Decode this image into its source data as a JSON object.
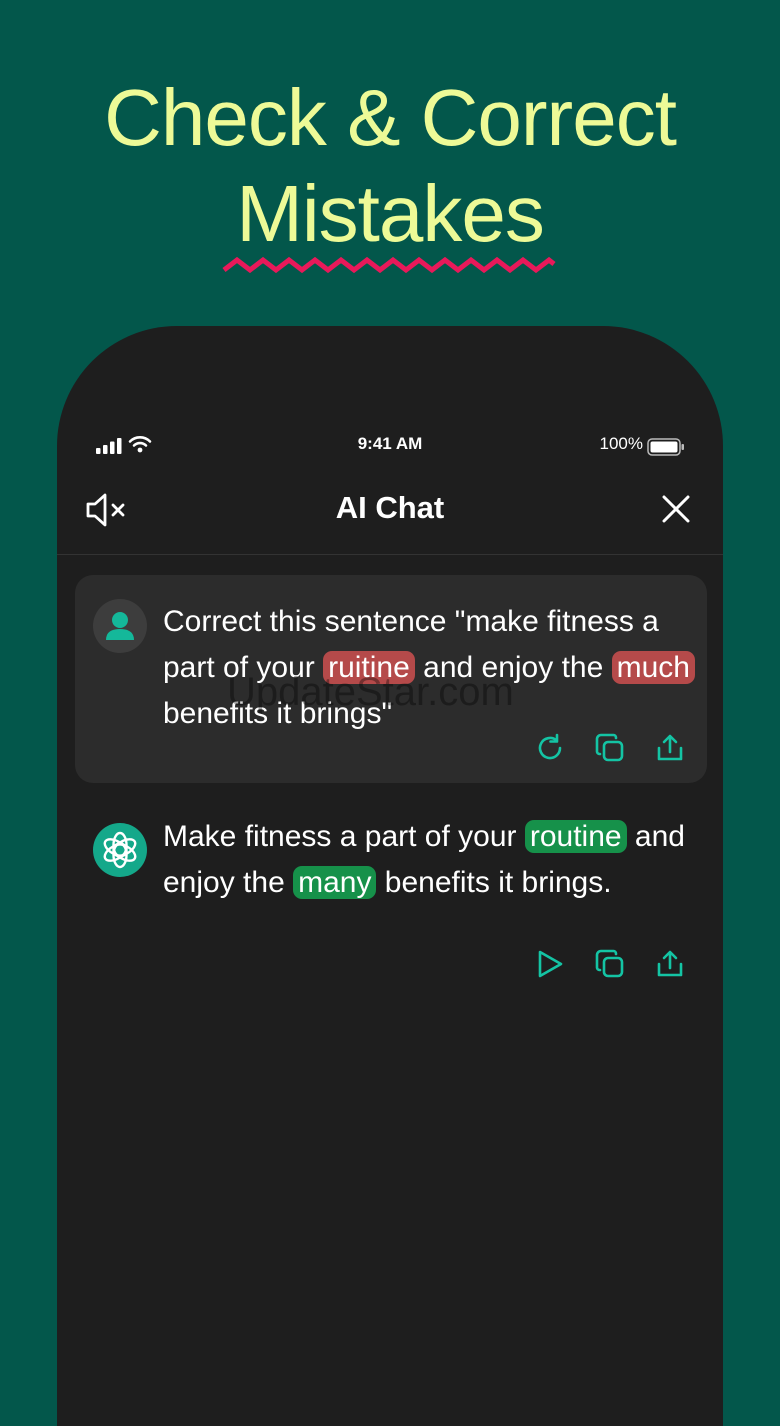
{
  "headline": {
    "line1": "Check & Correct",
    "line2": "Mistakes"
  },
  "status_bar": {
    "time": "9:41 AM",
    "battery": "100%"
  },
  "nav": {
    "title": "AI Chat",
    "left_icon": "speaker-mute-icon",
    "right_icon": "close-icon"
  },
  "user_message": {
    "part1": "Correct this sentence \"make fitness a part of your ",
    "error1": "ruitine",
    "part2": " and enjoy the ",
    "error2": "much",
    "part3": " benefits it brings\"",
    "actions": [
      "regenerate-icon",
      "copy-icon",
      "share-icon"
    ]
  },
  "ai_message": {
    "part1": "Make fitness a part of your ",
    "fix1": "routine",
    "part2": " and enjoy the ",
    "fix2": "many",
    "part3": " benefits it brings.",
    "actions": [
      "play-icon",
      "copy-icon",
      "share-icon"
    ]
  },
  "watermark": "UpdateStar.com",
  "colors": {
    "background": "#03574b",
    "headline": "#edfa97",
    "underline": "#e8195a",
    "accent": "#14c4a4",
    "error_highlight": "#b54a4a",
    "fix_highlight": "#16914a"
  }
}
